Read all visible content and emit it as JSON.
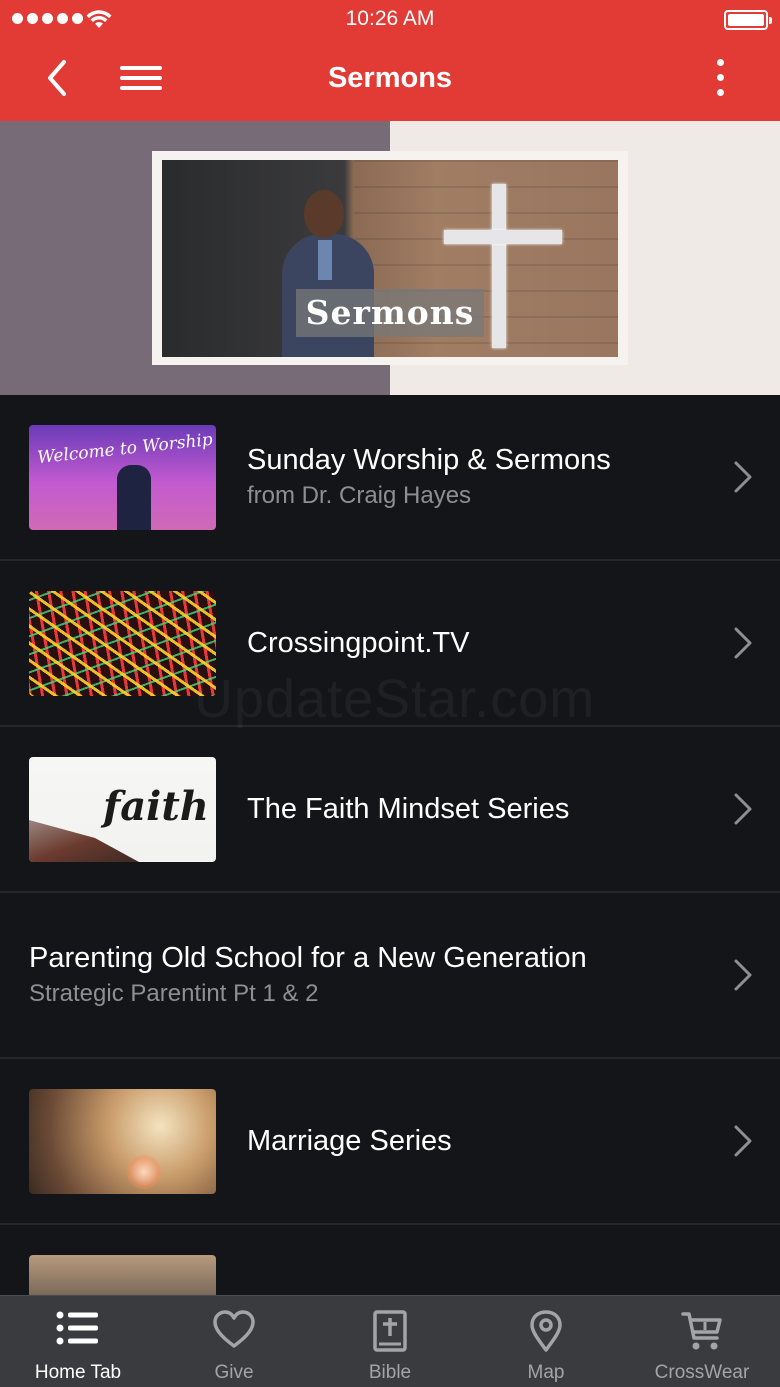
{
  "status_bar": {
    "time": "10:26 AM"
  },
  "nav": {
    "title": "Sermons"
  },
  "hero": {
    "label": "Sermons"
  },
  "list": {
    "items": [
      {
        "title": "Sunday Worship & Sermons",
        "subtitle": "from Dr. Craig Hayes",
        "thumb_text": "Welcome to Worship"
      },
      {
        "title": "Crossingpoint.TV",
        "subtitle": ""
      },
      {
        "title": "The Faith Mindset Series",
        "subtitle": "",
        "thumb_text": "faith"
      },
      {
        "title": "Parenting Old School for a New Generation",
        "subtitle": "Strategic Parentint Pt 1 & 2"
      },
      {
        "title": "Marriage Series",
        "subtitle": ""
      }
    ]
  },
  "watermark": "UpdateStar.com",
  "tabbar": {
    "tabs": [
      {
        "label": "Home Tab",
        "icon": "list-icon",
        "active": true
      },
      {
        "label": "Give",
        "icon": "heart-icon",
        "active": false
      },
      {
        "label": "Bible",
        "icon": "bible-icon",
        "active": false
      },
      {
        "label": "Map",
        "icon": "map-pin-icon",
        "active": false
      },
      {
        "label": "CrossWear",
        "icon": "cart-icon",
        "active": false
      }
    ]
  },
  "colors": {
    "header": "#e23a35",
    "background": "#141518",
    "tabbar": "#3a3b3f",
    "subtitle": "#8e8f93"
  }
}
